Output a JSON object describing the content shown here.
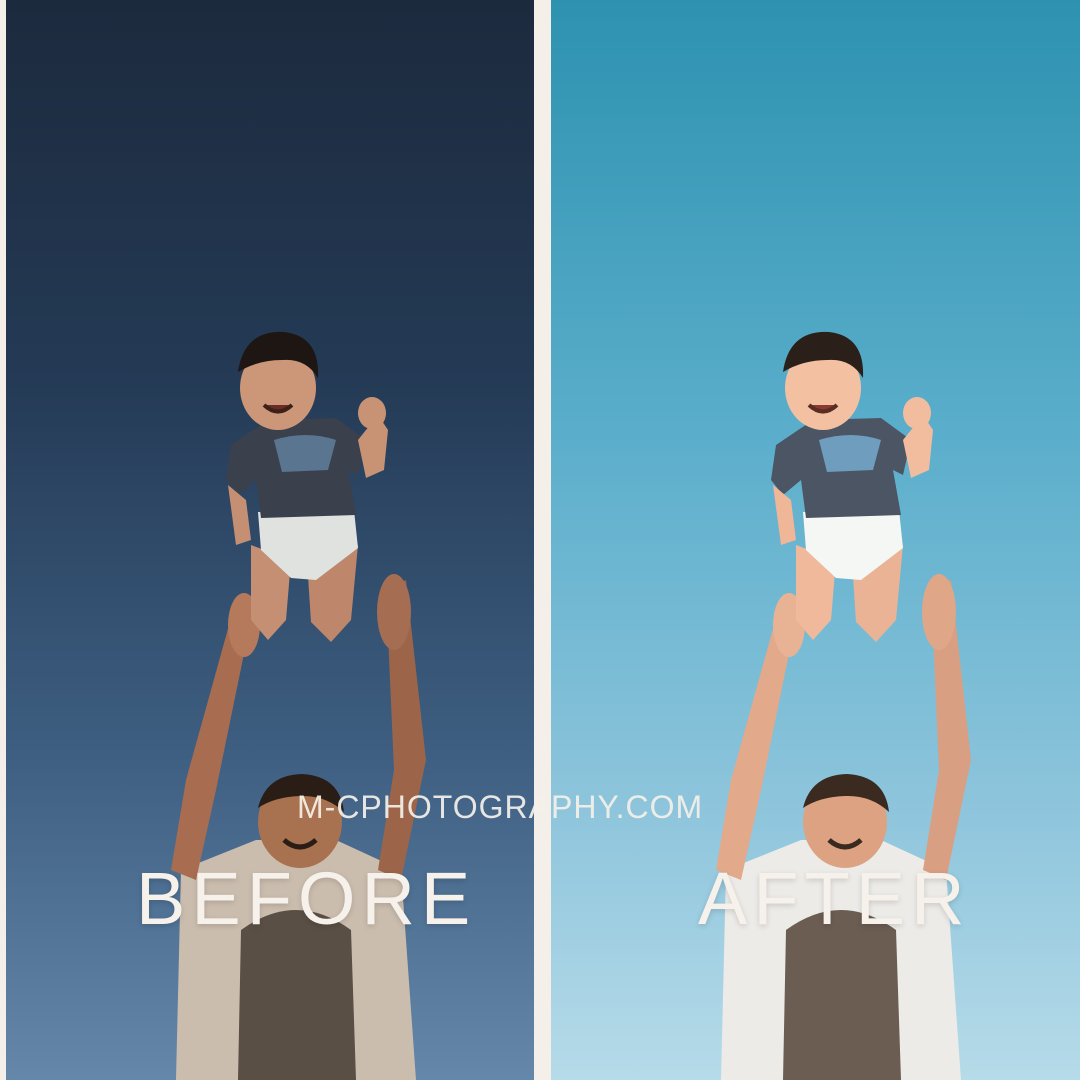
{
  "watermark": "M-CPHOTOGRAPHY.COM",
  "panels": {
    "before": {
      "label": "BEFORE",
      "sky_color_top": "#1c2a3d",
      "sky_color_bottom": "#6487aa"
    },
    "after": {
      "label": "AFTER",
      "sky_color_top": "#2d92b0",
      "sky_color_bottom": "#b6dbe9"
    }
  },
  "colors": {
    "divider": "#f4efe9",
    "text": "#f6f1ea"
  }
}
